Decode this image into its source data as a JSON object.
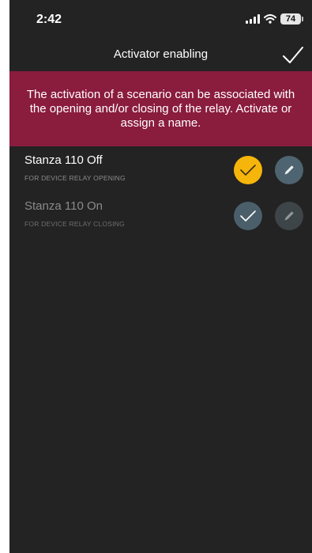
{
  "statusbar": {
    "time": "2:42",
    "battery": "74"
  },
  "header": {
    "title": "Activator enabling",
    "confirm_icon": "checkmark-icon"
  },
  "banner": {
    "text": "The activation of a scenario can be associated with the opening and/or closing of the relay. Activate or assign a name."
  },
  "items": [
    {
      "title": "Stanza 110 Off",
      "subtitle": "FOR DEVICE RELAY OPENING",
      "checked": true,
      "check_color": "#f5b50b",
      "edit_color": "#4e6470"
    },
    {
      "title": "Stanza 110 On",
      "subtitle": "FOR DEVICE RELAY CLOSING",
      "checked": false,
      "check_color": "#4b5f6a",
      "edit_color": "#3e4549"
    }
  ],
  "colors": {
    "background": "#232323",
    "banner": "#8a1c3e",
    "accent": "#f5b50b"
  }
}
